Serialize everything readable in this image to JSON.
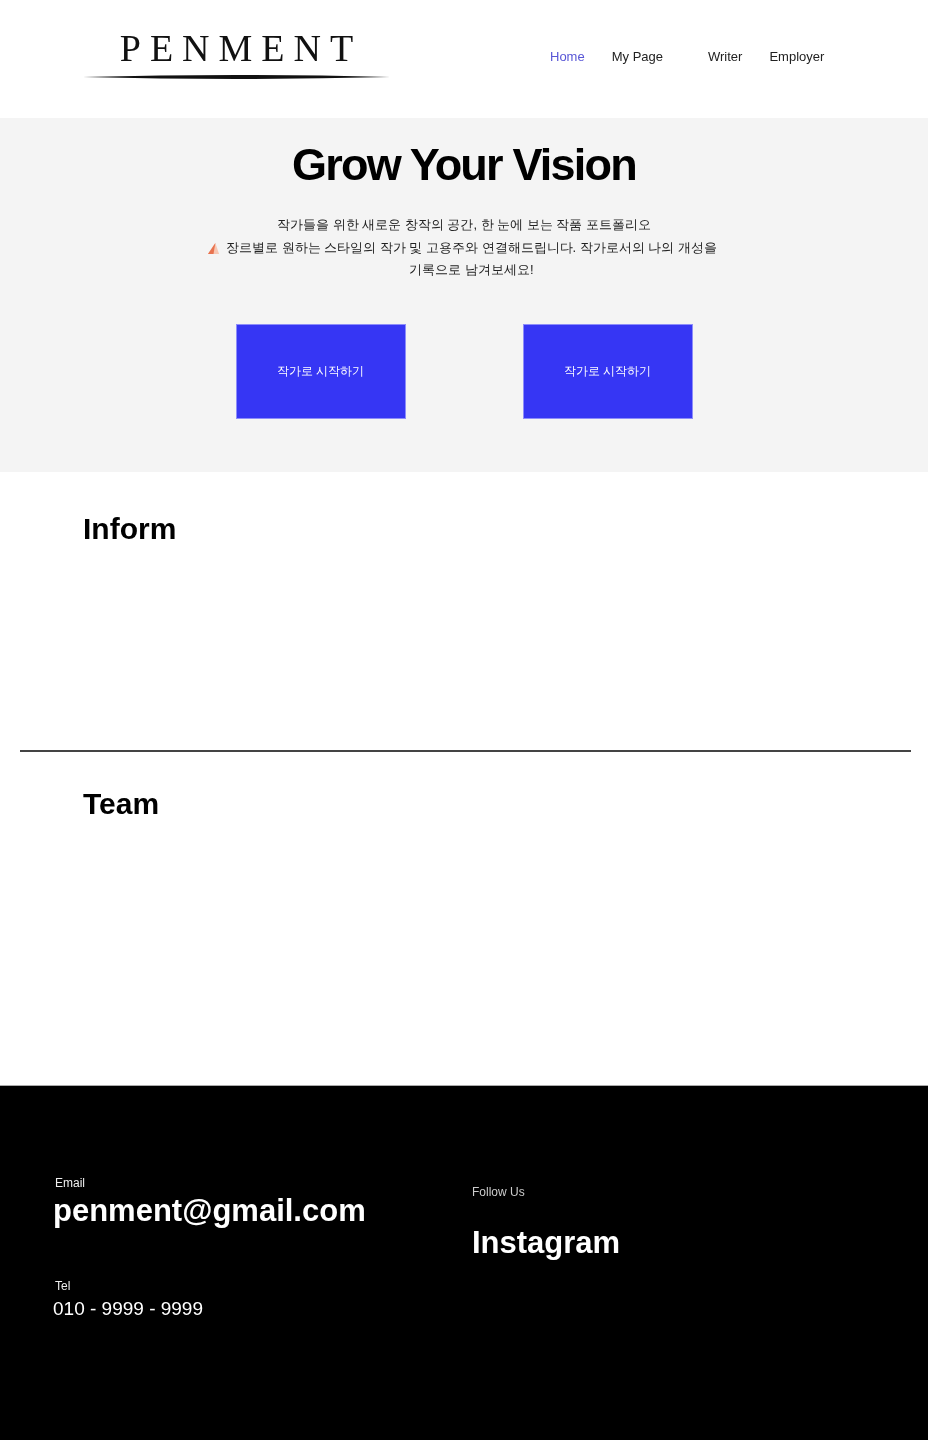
{
  "header": {
    "logo": "PENMENT",
    "nav": [
      {
        "label": "Home",
        "selected": true
      },
      {
        "label": "My Page",
        "selected": false
      },
      {
        "label": "Writer",
        "selected": false
      },
      {
        "label": "Employer",
        "selected": false
      }
    ]
  },
  "hero": {
    "title": "Grow Your Vision",
    "description": [
      {
        "text": "작가들을 위한 새로운 창작의 공간, 한 눈에 보는 작품 포트폴리오",
        "icon": false
      },
      {
        "text": "장르별로 원하는 스타일의 작가 및 고용주와 연결해드립니다. 작가로서의 나의 개성을 기록으로 남겨보세요!",
        "icon": true
      }
    ],
    "buttons": [
      {
        "label": "작가로 시작하기"
      },
      {
        "label": "작가로 시작하기"
      }
    ]
  },
  "sections": [
    {
      "heading": "Inform"
    },
    {
      "heading": "Team"
    }
  ],
  "footer": {
    "contacts": [
      {
        "label": "Email",
        "value": "penment@gmail.com",
        "kind": "email"
      },
      {
        "label": "Tel",
        "value": "010 - 9999 - 9999",
        "kind": "phone"
      }
    ],
    "social": {
      "label": "Follow Us",
      "links": [
        "Instagram"
      ]
    }
  }
}
